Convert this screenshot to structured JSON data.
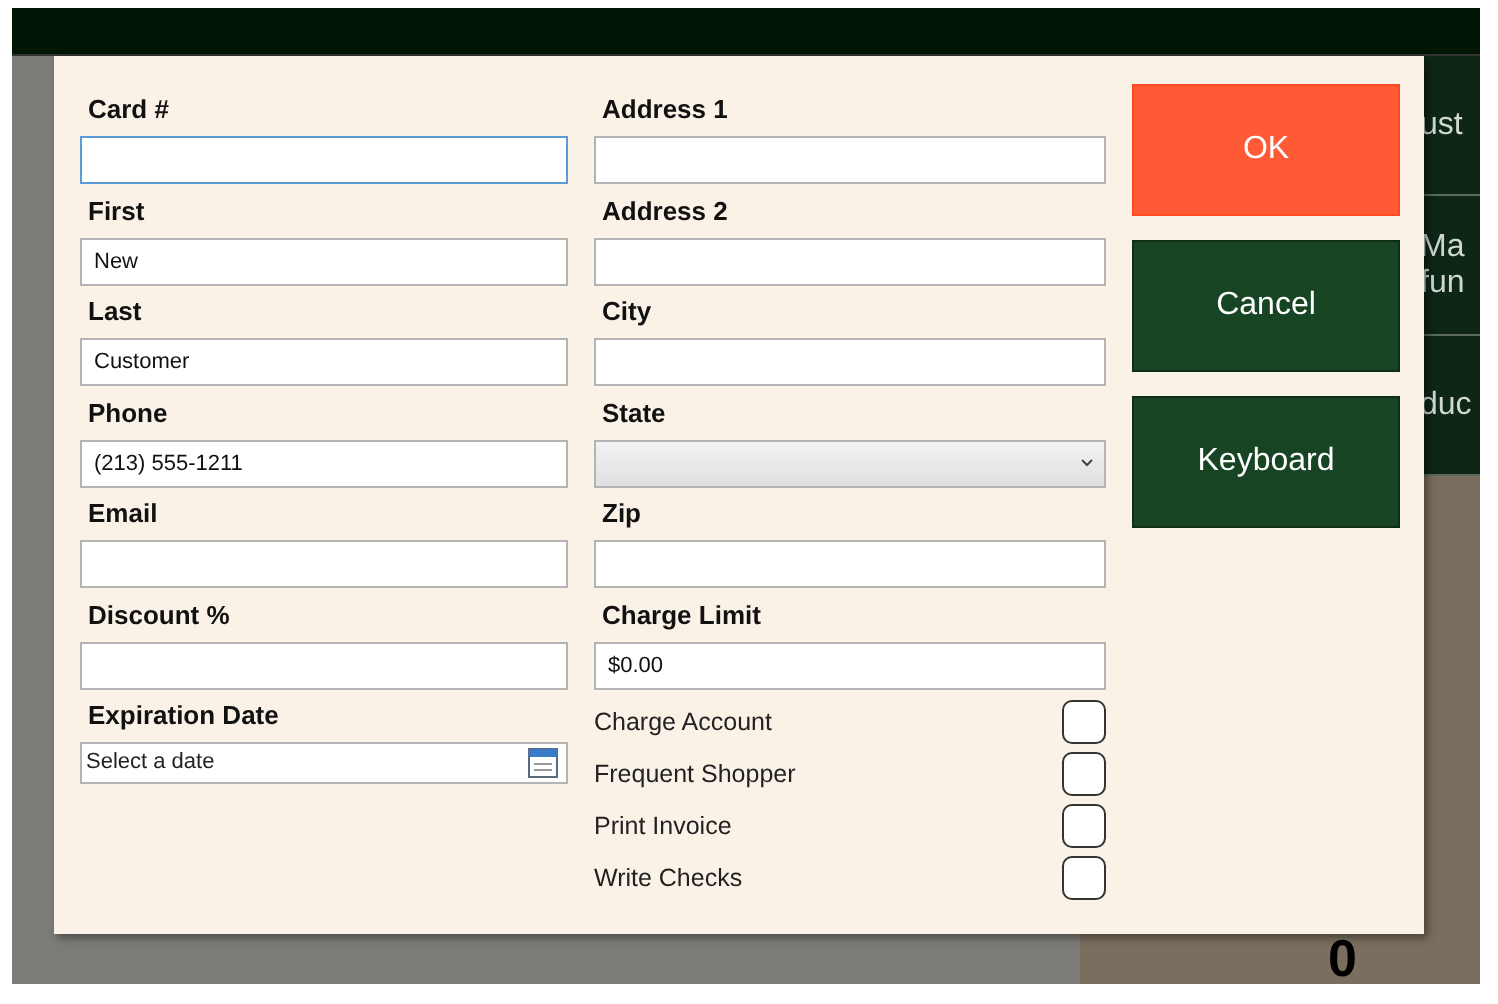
{
  "background": {
    "tiles": [
      {
        "lines": [
          "ust"
        ]
      },
      {
        "lines": [
          "Ma",
          "fun"
        ]
      },
      {
        "lines": [
          "duc"
        ]
      }
    ],
    "corner_text": "0"
  },
  "dialog": {
    "left_fields": [
      {
        "label": "Card #",
        "kind": "text",
        "focused": true
      },
      {
        "label": "First",
        "kind": "text",
        "value": "New",
        "focused": false
      },
      {
        "label": "Last",
        "kind": "text",
        "value": "Customer",
        "focused": false
      },
      {
        "label": "Phone",
        "kind": "text",
        "value": "(213) 555-1211",
        "focused": false
      },
      {
        "label": "Email",
        "kind": "text",
        "focused": false
      },
      {
        "label": "Discount %",
        "kind": "text",
        "focused": false
      },
      {
        "label": "Expiration Date",
        "kind": "date",
        "placeholder": "Select a date",
        "focused": false
      }
    ],
    "right_fields": [
      {
        "label": "Address 1",
        "kind": "text",
        "focused": false
      },
      {
        "label": "Address 2",
        "kind": "text",
        "focused": false
      },
      {
        "label": "City",
        "kind": "text",
        "focused": false
      },
      {
        "label": "State",
        "kind": "select",
        "focused": false
      },
      {
        "label": "Zip",
        "kind": "text",
        "focused": false
      },
      {
        "label": "Charge Limit",
        "kind": "text",
        "value": "$0.00",
        "focused": false
      }
    ],
    "checkboxes": [
      {
        "label": "Charge Account",
        "checked": false
      },
      {
        "label": "Frequent Shopper",
        "checked": false
      },
      {
        "label": "Print Invoice",
        "checked": false
      },
      {
        "label": "Write Checks",
        "checked": false
      }
    ],
    "buttons": [
      {
        "label": "OK",
        "kind": "primary"
      },
      {
        "label": "Cancel",
        "kind": "secondary"
      },
      {
        "label": "Keyboard",
        "kind": "secondary"
      }
    ]
  }
}
